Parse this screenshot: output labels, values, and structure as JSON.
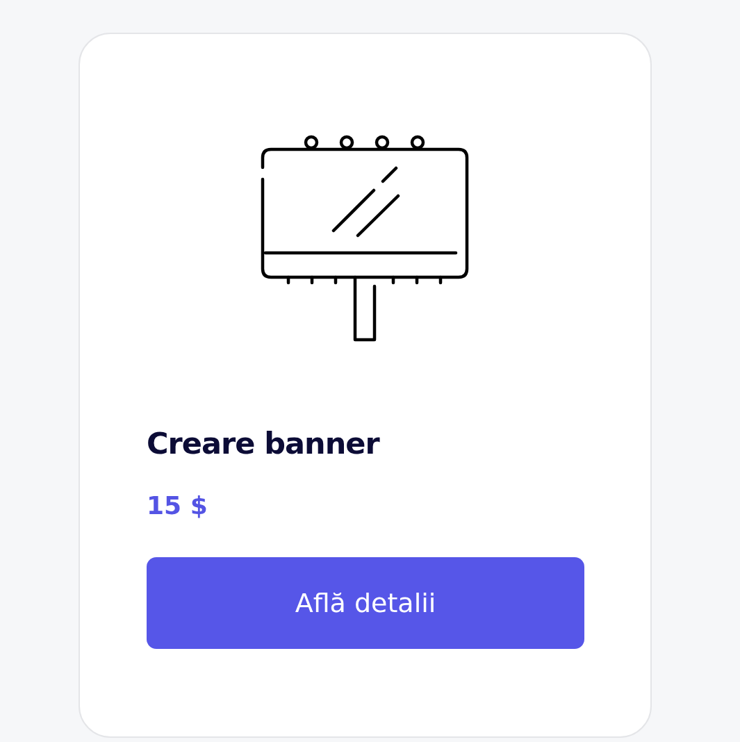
{
  "card": {
    "title": "Creare banner",
    "price": "15 $",
    "button": "Află detalii"
  }
}
